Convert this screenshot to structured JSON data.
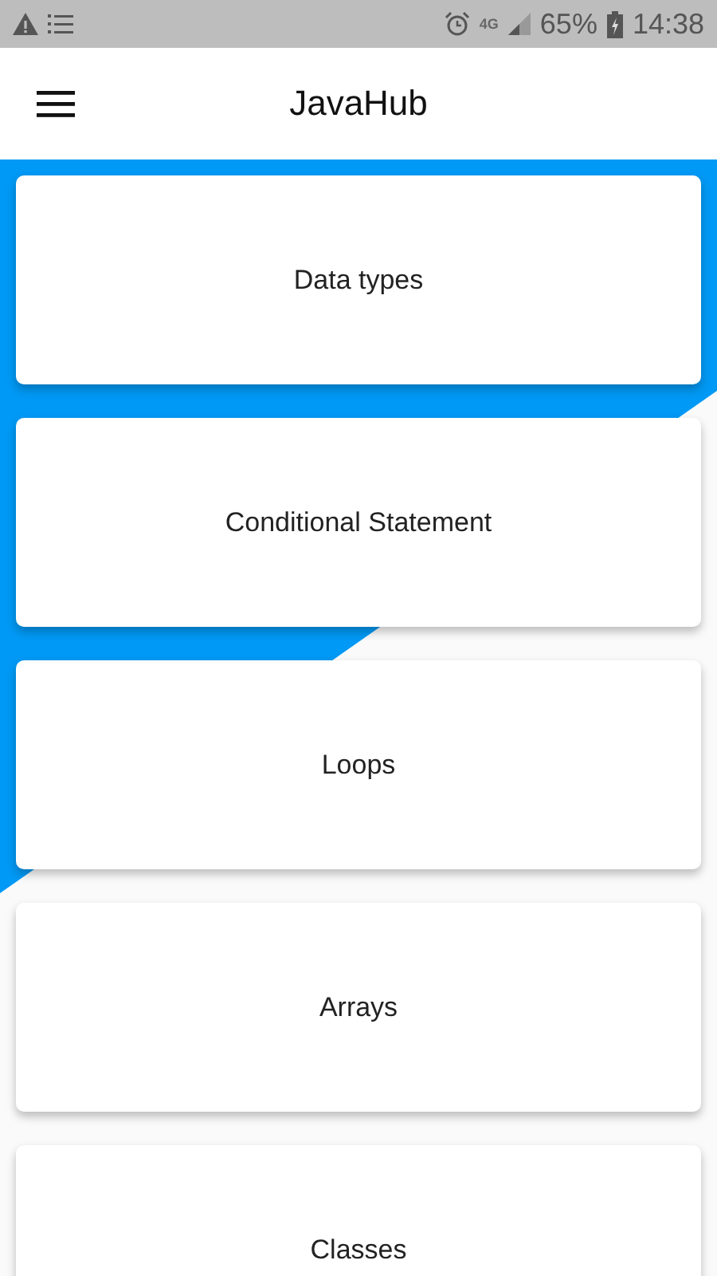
{
  "status_bar": {
    "network": "4G",
    "battery": "65%",
    "time": "14:38"
  },
  "app_bar": {
    "title": "JavaHub"
  },
  "topics": [
    {
      "label": "Data types"
    },
    {
      "label": "Conditional Statement"
    },
    {
      "label": "Loops"
    },
    {
      "label": "Arrays"
    },
    {
      "label": "Classes"
    }
  ]
}
